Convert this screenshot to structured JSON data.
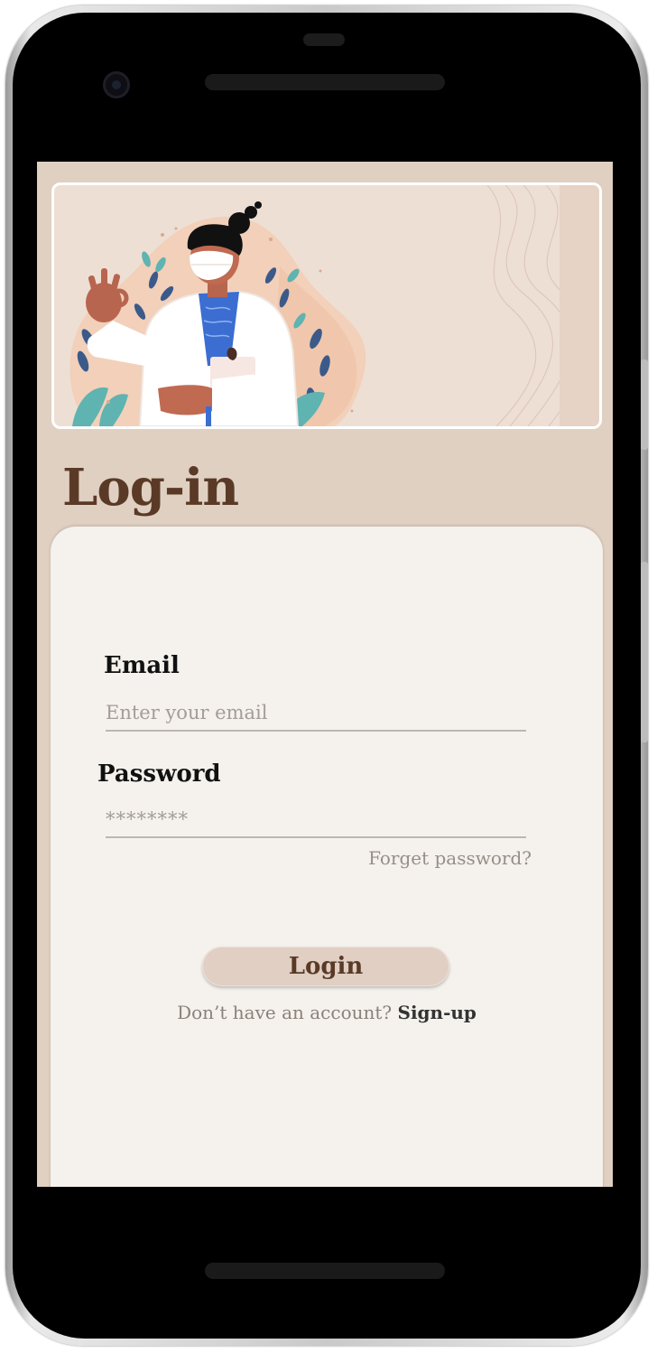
{
  "page": {
    "title": "Log-in"
  },
  "form": {
    "email_label": "Email",
    "email_placeholder": "Enter your email",
    "password_label": "Password",
    "password_placeholder": "********",
    "forgot_password": "Forget password?",
    "login_label": "Login",
    "signup_prompt": "Don’t have an account?",
    "signup_link": "Sign-up"
  },
  "colors": {
    "screen_background": "#e0d0c2",
    "card_background": "#f5f1ec",
    "title_brown": "#5a3a27",
    "button_background": "#e0cfc2"
  },
  "icons": {
    "banner": "doctor-illustration"
  }
}
